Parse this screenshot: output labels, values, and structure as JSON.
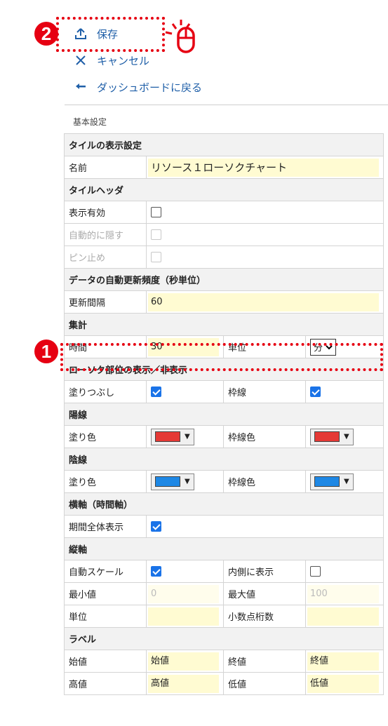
{
  "nav": {
    "save_label": "保存",
    "cancel_label": "キャンセル",
    "back_label": "ダッシュボードに戻る"
  },
  "markers": {
    "one": "1",
    "two": "2"
  },
  "section_label": "基本設定",
  "form": {
    "tile_display_header": "タイルの表示設定",
    "name_label": "名前",
    "name_value": "リソース１ローソクチャート",
    "tile_header_header": "タイルヘッダ",
    "show_label": "表示有効",
    "autohide_label": "自動的に隠す",
    "pin_label": "ピン止め",
    "refresh_header": "データの自動更新頻度（秒単位）",
    "interval_label": "更新間隔",
    "interval_value": "60",
    "aggregate_header": "集計",
    "time_label": "時間",
    "time_value": "30",
    "unit_label": "単位",
    "unit_value": "分",
    "candle_header": "ローソク部位の表示／非表示",
    "fill_label": "塗りつぶし",
    "border_label": "枠線",
    "bull_header": "陽線",
    "bear_header": "陰線",
    "fill_color_label": "塗り色",
    "border_color_label": "枠線色",
    "xaxis_header": "横軸（時間軸）",
    "full_period_label": "期間全体表示",
    "yaxis_header": "縦軸",
    "autoscale_label": "自動スケール",
    "inside_label": "内側に表示",
    "min_label": "最小値",
    "min_value": "0",
    "max_label": "最大値",
    "max_value": "100",
    "yunit_label": "単位",
    "decimals_label": "小数点桁数",
    "label_header": "ラベル",
    "open_label": "始値",
    "open_value": "始値",
    "close_label": "終値",
    "close_value": "終値",
    "high_label": "高値",
    "high_value": "高値",
    "low_label": "低値",
    "low_value": "低値"
  },
  "state": {
    "show_enabled": false,
    "autohide": false,
    "pin": false,
    "fill_enabled": true,
    "border_enabled": true,
    "full_period": true,
    "autoscale": true,
    "inside": false
  },
  "colors": {
    "bull_fill": "#e53935",
    "bull_border": "#e53935",
    "bear_fill": "#1e88e5",
    "bear_border": "#1e88e5",
    "link": "#1f5fa8",
    "marker": "#e60012"
  }
}
